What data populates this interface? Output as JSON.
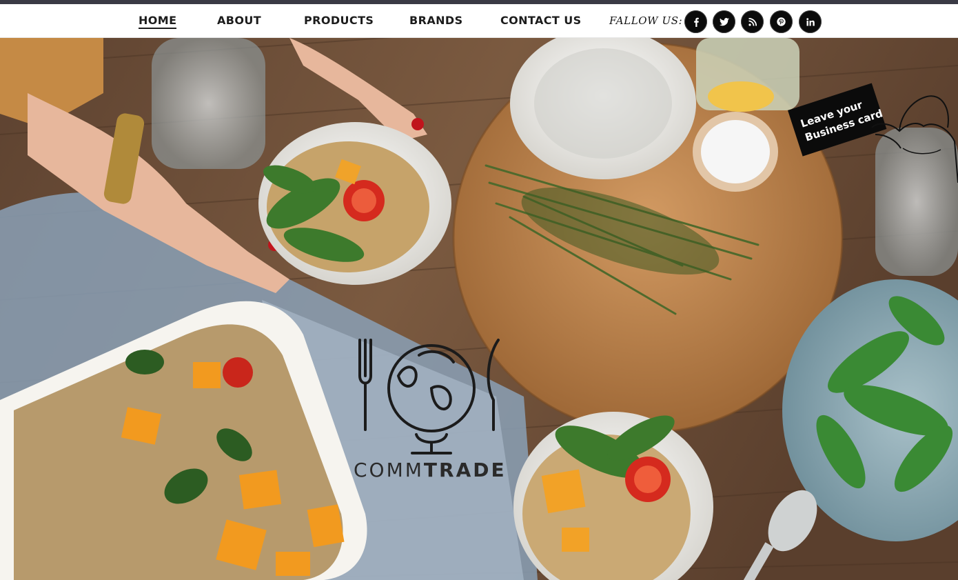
{
  "nav": {
    "items": [
      {
        "label": "HOME",
        "active": true
      },
      {
        "label": "ABOUT"
      },
      {
        "label": "PRODUCTS"
      },
      {
        "label": "BRANDS"
      },
      {
        "label": "CONTACT US"
      }
    ],
    "follow_label": "FALLOW US:",
    "social": [
      {
        "icon": "facebook-icon"
      },
      {
        "icon": "twitter-icon"
      },
      {
        "icon": "rss-icon"
      },
      {
        "icon": "pinterest-icon"
      },
      {
        "icon": "linkedin-icon"
      }
    ]
  },
  "hero": {
    "logo_text_light": "COMM",
    "logo_text_bold": "TRADE",
    "card_line1": "Leave your",
    "card_line2": "Business card"
  },
  "colors": {
    "nav_bg": "#ffffff",
    "top_strip": "#3a3a45",
    "social_bg": "#0b0b0b",
    "table_wood": "#6b4b33",
    "cutting_board": "#b97a45",
    "cloth_blue": "#8fa3b8",
    "bowl_white": "#f1f0ec"
  }
}
